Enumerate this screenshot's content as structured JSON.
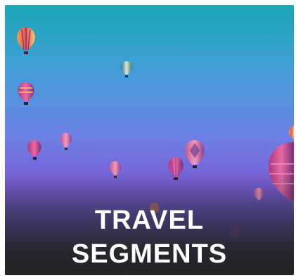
{
  "tile": {
    "title_line1": "TRAVEL",
    "title_line2": "SEGMENTS",
    "background_icon": "hot-air-balloons-photo",
    "colors": {
      "sky_top": "#1aa7b6",
      "sky_mid": "#6b82e6",
      "sky_bottom": "#2a2a2e",
      "title": "#ffffff"
    }
  }
}
